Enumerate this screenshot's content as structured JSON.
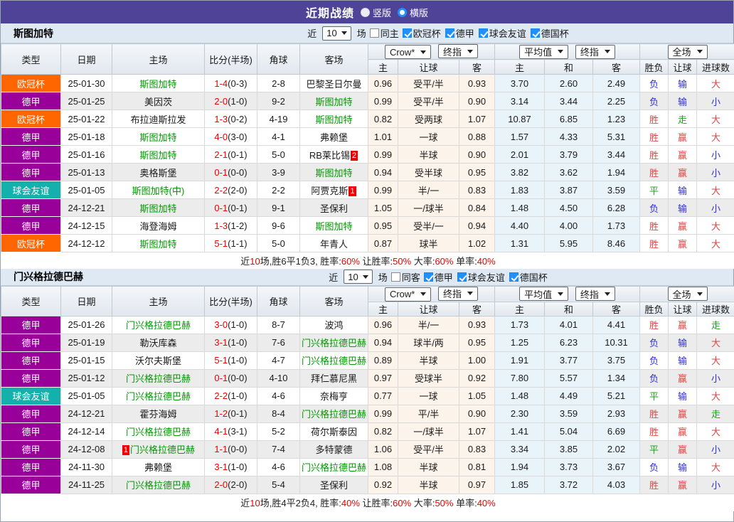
{
  "titlebar": {
    "title": "近期战绩",
    "vertical_label": "竖版",
    "horizontal_label": "横版"
  },
  "filter": {
    "near_label": "近",
    "recent_count": "10",
    "games_label": "场"
  },
  "selects": {
    "odds_source": "Crow*",
    "odds_stage": "终指",
    "euro_source": "平均值",
    "euro_stage": "终指",
    "scope": "全场"
  },
  "columns": [
    "类型",
    "日期",
    "主场",
    "比分(半场)",
    "角球",
    "客场",
    "主",
    "让球",
    "客",
    "主",
    "和",
    "客",
    "胜负",
    "让球",
    "进球数"
  ],
  "colors": {
    "topbar_purple": "#4f4398",
    "uefa_badge": "#ff6600",
    "bundesliga_badge": "#990099",
    "friendly_badge": "#14b0ab",
    "team_green": "#009900",
    "score_red": "#ee0000",
    "win_red": "#e04545",
    "lose_blue": "#3030cf",
    "draw_green": "#22a022",
    "checkbox_blue": "#1e90ff"
  },
  "sections": [
    {
      "team": "斯图加特",
      "venue_label": "同主",
      "venue_checked": false,
      "leagues": [
        "欧冠杯",
        "德甲",
        "球会友谊",
        "德国杯"
      ],
      "rows": [
        {
          "lt": "欧冠杯",
          "lc": "uefa",
          "d": "25-01-30",
          "h": {
            "t": "斯图加特",
            "g": 1
          },
          "s": [
            "1-4",
            "(0-3)"
          ],
          "c": "2-8",
          "a": {
            "t": "巴黎圣日尔曼"
          },
          "o": [
            "0.96",
            "受平/半",
            "0.93"
          ],
          "v": [
            "3.70",
            "2.60",
            "2.49"
          ],
          "r": [
            [
              "负",
              "b"
            ],
            [
              "输",
              "b"
            ],
            [
              "大",
              "r"
            ]
          ],
          "alt": 0
        },
        {
          "lt": "德甲",
          "lc": "bund",
          "d": "25-01-25",
          "h": {
            "t": "美因茨"
          },
          "s": [
            "2-0",
            "(1-0)"
          ],
          "c": "9-2",
          "a": {
            "t": "斯图加特",
            "g": 1
          },
          "o": [
            "0.99",
            "受平/半",
            "0.90"
          ],
          "v": [
            "3.14",
            "3.44",
            "2.25"
          ],
          "r": [
            [
              "负",
              "b"
            ],
            [
              "输",
              "b"
            ],
            [
              "小",
              "b"
            ]
          ],
          "alt": 1
        },
        {
          "lt": "欧冠杯",
          "lc": "uefa",
          "d": "25-01-22",
          "h": {
            "t": "布拉迪斯拉发"
          },
          "s": [
            "1-3",
            "(0-2)"
          ],
          "c": "4-19",
          "a": {
            "t": "斯图加特",
            "g": 1
          },
          "o": [
            "0.82",
            "受两球",
            "1.07"
          ],
          "v": [
            "10.87",
            "6.85",
            "1.23"
          ],
          "r": [
            [
              "胜",
              "r"
            ],
            [
              "走",
              "g"
            ],
            [
              "大",
              "r"
            ]
          ],
          "alt": 0
        },
        {
          "lt": "德甲",
          "lc": "bund",
          "d": "25-01-18",
          "h": {
            "t": "斯图加特",
            "g": 1
          },
          "s": [
            "4-0",
            "(3-0)"
          ],
          "c": "4-1",
          "a": {
            "t": "弗赖堡"
          },
          "o": [
            "1.01",
            "一球",
            "0.88"
          ],
          "v": [
            "1.57",
            "4.33",
            "5.31"
          ],
          "r": [
            [
              "胜",
              "r"
            ],
            [
              "赢",
              "r"
            ],
            [
              "大",
              "r"
            ]
          ],
          "alt": 0
        },
        {
          "lt": "德甲",
          "lc": "bund",
          "d": "25-01-16",
          "h": {
            "t": "斯图加特",
            "g": 1
          },
          "s": [
            "2-1",
            "(0-1)"
          ],
          "c": "5-0",
          "a": {
            "t": "RB莱比锡",
            "br": "2"
          },
          "o": [
            "0.99",
            "半球",
            "0.90"
          ],
          "v": [
            "2.01",
            "3.79",
            "3.44"
          ],
          "r": [
            [
              "胜",
              "r"
            ],
            [
              "赢",
              "r"
            ],
            [
              "小",
              "b"
            ]
          ],
          "alt": 0
        },
        {
          "lt": "德甲",
          "lc": "bund",
          "d": "25-01-13",
          "h": {
            "t": "奥格斯堡"
          },
          "s": [
            "0-1",
            "(0-0)"
          ],
          "c": "3-9",
          "a": {
            "t": "斯图加特",
            "g": 1
          },
          "o": [
            "0.94",
            "受半球",
            "0.95"
          ],
          "v": [
            "3.82",
            "3.62",
            "1.94"
          ],
          "r": [
            [
              "胜",
              "r"
            ],
            [
              "赢",
              "r"
            ],
            [
              "小",
              "b"
            ]
          ],
          "alt": 1
        },
        {
          "lt": "球会友谊",
          "lc": "frnd",
          "d": "25-01-05",
          "h": {
            "t": "斯图加特(中)",
            "g": 1
          },
          "s": [
            "2-2",
            "(2-0)"
          ],
          "c": "2-2",
          "a": {
            "t": "阿贾克斯",
            "br": "1"
          },
          "o": [
            "0.99",
            "半/一",
            "0.83"
          ],
          "v": [
            "1.83",
            "3.87",
            "3.59"
          ],
          "r": [
            [
              "平",
              "g"
            ],
            [
              "输",
              "b"
            ],
            [
              "大",
              "r"
            ]
          ],
          "alt": 0
        },
        {
          "lt": "德甲",
          "lc": "bund",
          "d": "24-12-21",
          "h": {
            "t": "斯图加特",
            "g": 1
          },
          "s": [
            "0-1",
            "(0-1)"
          ],
          "c": "9-1",
          "a": {
            "t": "圣保利"
          },
          "o": [
            "1.05",
            "一/球半",
            "0.84"
          ],
          "v": [
            "1.48",
            "4.50",
            "6.28"
          ],
          "r": [
            [
              "负",
              "b"
            ],
            [
              "输",
              "b"
            ],
            [
              "小",
              "b"
            ]
          ],
          "alt": 1
        },
        {
          "lt": "德甲",
          "lc": "bund",
          "d": "24-12-15",
          "h": {
            "t": "海登海姆"
          },
          "s": [
            "1-3",
            "(1-2)"
          ],
          "c": "9-6",
          "a": {
            "t": "斯图加特",
            "g": 1
          },
          "o": [
            "0.95",
            "受半/一",
            "0.94"
          ],
          "v": [
            "4.40",
            "4.00",
            "1.73"
          ],
          "r": [
            [
              "胜",
              "r"
            ],
            [
              "赢",
              "r"
            ],
            [
              "大",
              "r"
            ]
          ],
          "alt": 0
        },
        {
          "lt": "欧冠杯",
          "lc": "uefa",
          "d": "24-12-12",
          "h": {
            "t": "斯图加特",
            "g": 1
          },
          "s": [
            "5-1",
            "(1-1)"
          ],
          "c": "5-0",
          "a": {
            "t": "年青人"
          },
          "o": [
            "0.87",
            "球半",
            "1.02"
          ],
          "v": [
            "1.31",
            "5.95",
            "8.46"
          ],
          "r": [
            [
              "胜",
              "r"
            ],
            [
              "赢",
              "r"
            ],
            [
              "大",
              "r"
            ]
          ],
          "alt": 0
        }
      ],
      "summary": [
        [
          "近",
          "n"
        ],
        [
          "10",
          "hl"
        ],
        [
          "场,胜6平1负3, 胜率:",
          "n"
        ],
        [
          "60%",
          "hl"
        ],
        [
          " 让胜率:",
          "n"
        ],
        [
          "50%",
          "hl"
        ],
        [
          " 大率:",
          "n"
        ],
        [
          "60%",
          "hl"
        ],
        [
          " 单率:",
          "n"
        ],
        [
          "40%",
          "hl"
        ]
      ]
    },
    {
      "team": "门兴格拉德巴赫",
      "venue_label": "同客",
      "venue_checked": false,
      "leagues": [
        "德甲",
        "球会友谊",
        "德国杯"
      ],
      "rows": [
        {
          "lt": "德甲",
          "lc": "bund",
          "d": "25-01-26",
          "h": {
            "t": "门兴格拉德巴赫",
            "g": 1
          },
          "s": [
            "3-0",
            "(1-0)"
          ],
          "c": "8-7",
          "a": {
            "t": "波鸿"
          },
          "o": [
            "0.96",
            "半/一",
            "0.93"
          ],
          "v": [
            "1.73",
            "4.01",
            "4.41"
          ],
          "r": [
            [
              "胜",
              "r"
            ],
            [
              "赢",
              "r"
            ],
            [
              "走",
              "g"
            ]
          ],
          "alt": 0
        },
        {
          "lt": "德甲",
          "lc": "bund",
          "d": "25-01-19",
          "h": {
            "t": "勒沃库森"
          },
          "s": [
            "3-1",
            "(1-0)"
          ],
          "c": "7-6",
          "a": {
            "t": "门兴格拉德巴赫",
            "g": 1
          },
          "o": [
            "0.94",
            "球半/两",
            "0.95"
          ],
          "v": [
            "1.25",
            "6.23",
            "10.31"
          ],
          "r": [
            [
              "负",
              "b"
            ],
            [
              "输",
              "b"
            ],
            [
              "大",
              "r"
            ]
          ],
          "alt": 1
        },
        {
          "lt": "德甲",
          "lc": "bund",
          "d": "25-01-15",
          "h": {
            "t": "沃尔夫斯堡"
          },
          "s": [
            "5-1",
            "(1-0)"
          ],
          "c": "4-7",
          "a": {
            "t": "门兴格拉德巴赫",
            "g": 1
          },
          "o": [
            "0.89",
            "半球",
            "1.00"
          ],
          "v": [
            "1.91",
            "3.77",
            "3.75"
          ],
          "r": [
            [
              "负",
              "b"
            ],
            [
              "输",
              "b"
            ],
            [
              "大",
              "r"
            ]
          ],
          "alt": 0
        },
        {
          "lt": "德甲",
          "lc": "bund",
          "d": "25-01-12",
          "h": {
            "t": "门兴格拉德巴赫",
            "g": 1
          },
          "s": [
            "0-1",
            "(0-0)"
          ],
          "c": "4-10",
          "a": {
            "t": "拜仁慕尼黑"
          },
          "o": [
            "0.97",
            "受球半",
            "0.92"
          ],
          "v": [
            "7.80",
            "5.57",
            "1.34"
          ],
          "r": [
            [
              "负",
              "b"
            ],
            [
              "赢",
              "r"
            ],
            [
              "小",
              "b"
            ]
          ],
          "alt": 1
        },
        {
          "lt": "球会友谊",
          "lc": "frnd",
          "d": "25-01-05",
          "h": {
            "t": "门兴格拉德巴赫",
            "g": 1
          },
          "s": [
            "2-2",
            "(1-0)"
          ],
          "c": "4-6",
          "a": {
            "t": "奈梅亨"
          },
          "o": [
            "0.77",
            "一球",
            "1.05"
          ],
          "v": [
            "1.48",
            "4.49",
            "5.21"
          ],
          "r": [
            [
              "平",
              "g"
            ],
            [
              "输",
              "b"
            ],
            [
              "大",
              "r"
            ]
          ],
          "alt": 0
        },
        {
          "lt": "德甲",
          "lc": "bund",
          "d": "24-12-21",
          "h": {
            "t": "霍芬海姆"
          },
          "s": [
            "1-2",
            "(0-1)"
          ],
          "c": "8-4",
          "a": {
            "t": "门兴格拉德巴赫",
            "g": 1
          },
          "o": [
            "0.99",
            "平/半",
            "0.90"
          ],
          "v": [
            "2.30",
            "3.59",
            "2.93"
          ],
          "r": [
            [
              "胜",
              "r"
            ],
            [
              "赢",
              "r"
            ],
            [
              "走",
              "g"
            ]
          ],
          "alt": 1
        },
        {
          "lt": "德甲",
          "lc": "bund",
          "d": "24-12-14",
          "h": {
            "t": "门兴格拉德巴赫",
            "g": 1
          },
          "s": [
            "4-1",
            "(3-1)"
          ],
          "c": "5-2",
          "a": {
            "t": "荷尔斯泰因"
          },
          "o": [
            "0.82",
            "一/球半",
            "1.07"
          ],
          "v": [
            "1.41",
            "5.04",
            "6.69"
          ],
          "r": [
            [
              "胜",
              "r"
            ],
            [
              "赢",
              "r"
            ],
            [
              "大",
              "r"
            ]
          ],
          "alt": 0
        },
        {
          "lt": "德甲",
          "lc": "bund",
          "d": "24-12-08",
          "h": {
            "t": "门兴格拉德巴赫",
            "g": 1,
            "bl": "1"
          },
          "s": [
            "1-1",
            "(0-0)"
          ],
          "c": "7-4",
          "a": {
            "t": "多特蒙德"
          },
          "o": [
            "1.06",
            "受平/半",
            "0.83"
          ],
          "v": [
            "3.34",
            "3.85",
            "2.02"
          ],
          "r": [
            [
              "平",
              "g"
            ],
            [
              "赢",
              "r"
            ],
            [
              "小",
              "b"
            ]
          ],
          "alt": 1
        },
        {
          "lt": "德甲",
          "lc": "bund",
          "d": "24-11-30",
          "h": {
            "t": "弗赖堡"
          },
          "s": [
            "3-1",
            "(1-0)"
          ],
          "c": "4-6",
          "a": {
            "t": "门兴格拉德巴赫",
            "g": 1
          },
          "o": [
            "1.08",
            "半球",
            "0.81"
          ],
          "v": [
            "1.94",
            "3.73",
            "3.67"
          ],
          "r": [
            [
              "负",
              "b"
            ],
            [
              "输",
              "b"
            ],
            [
              "大",
              "r"
            ]
          ],
          "alt": 0
        },
        {
          "lt": "德甲",
          "lc": "bund",
          "d": "24-11-25",
          "h": {
            "t": "门兴格拉德巴赫",
            "g": 1
          },
          "s": [
            "2-0",
            "(2-0)"
          ],
          "c": "5-4",
          "a": {
            "t": "圣保利"
          },
          "o": [
            "0.92",
            "半球",
            "0.97"
          ],
          "v": [
            "1.85",
            "3.72",
            "4.03"
          ],
          "r": [
            [
              "胜",
              "r"
            ],
            [
              "赢",
              "r"
            ],
            [
              "小",
              "b"
            ]
          ],
          "alt": 1
        }
      ],
      "summary": [
        [
          "近",
          "n"
        ],
        [
          "10",
          "hl"
        ],
        [
          "场,胜4平2负4, 胜率:",
          "n"
        ],
        [
          "40%",
          "hl"
        ],
        [
          " 让胜率:",
          "n"
        ],
        [
          "60%",
          "hl"
        ],
        [
          " 大率:",
          "n"
        ],
        [
          "50%",
          "hl"
        ],
        [
          " 单率:",
          "n"
        ],
        [
          "40%",
          "hl"
        ]
      ]
    }
  ]
}
